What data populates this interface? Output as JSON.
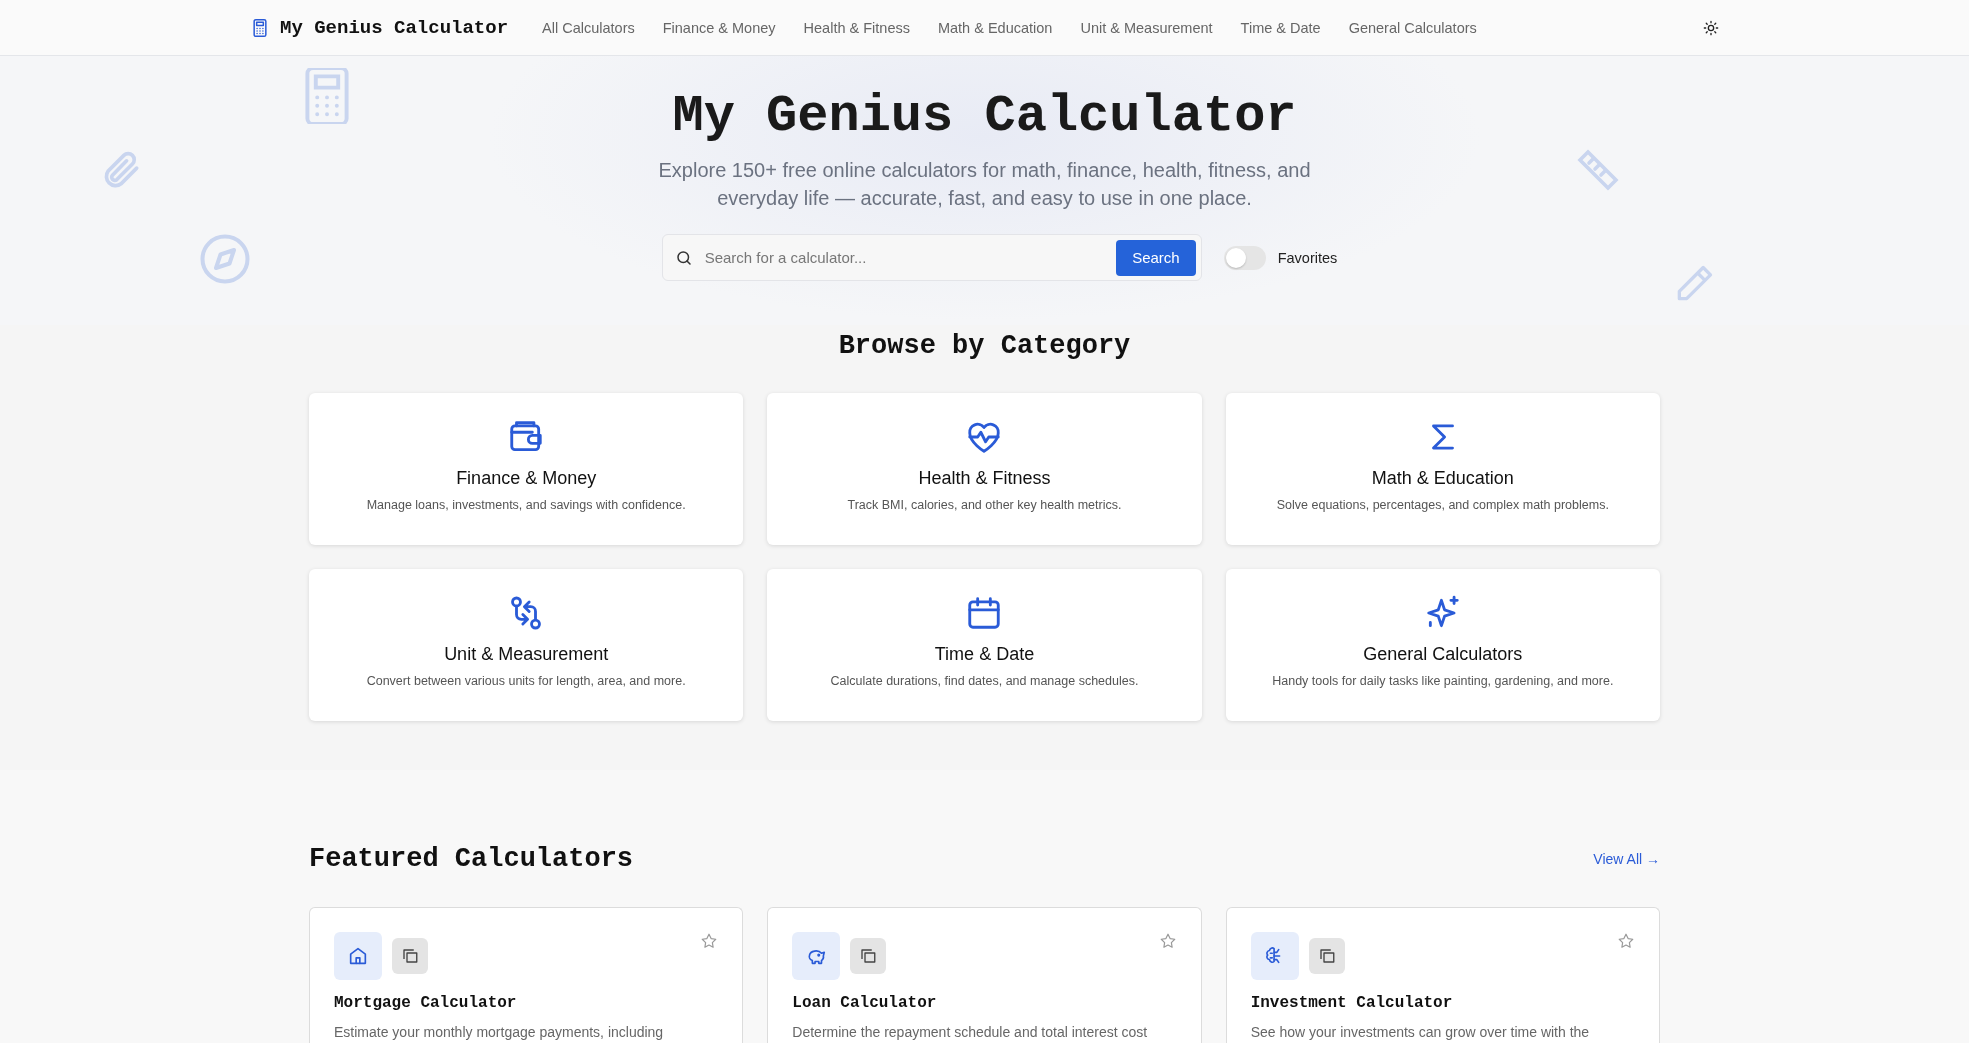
{
  "header": {
    "logo": "My Genius Calculator",
    "nav": [
      "All Calculators",
      "Finance & Money",
      "Health & Fitness",
      "Math & Education",
      "Unit & Measurement",
      "Time & Date",
      "General Calculators"
    ]
  },
  "hero": {
    "title": "My Genius Calculator",
    "subtitle": "Explore 150+ free online calculators for math, finance, health, fitness, and everyday life — accurate, fast, and easy to use in one place.",
    "search": {
      "placeholder": "Search for a calculator...",
      "button": "Search"
    },
    "favorites": {
      "label": "Favorites",
      "on": false
    }
  },
  "categories": {
    "title": "Browse by Category",
    "items": [
      {
        "title": "Finance & Money",
        "description": "Manage loans, investments, and savings with confidence."
      },
      {
        "title": "Health & Fitness",
        "description": "Track BMI, calories, and other key health metrics."
      },
      {
        "title": "Math & Education",
        "description": "Solve equations, percentages, and complex math problems."
      },
      {
        "title": "Unit & Measurement",
        "description": "Convert between various units for length, area, and more."
      },
      {
        "title": "Time & Date",
        "description": "Calculate durations, find dates, and manage schedules."
      },
      {
        "title": "General Calculators",
        "description": "Handy tools for daily tasks like painting, gardening, and more."
      }
    ]
  },
  "featured": {
    "title": "Featured Calculators",
    "view_all": "View All →",
    "items": [
      {
        "title": "Mortgage Calculator",
        "description": "Estimate your monthly mortgage payments, including",
        "favorite": false
      },
      {
        "title": "Loan Calculator",
        "description": "Determine the repayment schedule and total interest cost",
        "favorite": false
      },
      {
        "title": "Investment Calculator",
        "description": "See how your investments can grow over time with the",
        "favorite": false
      }
    ]
  }
}
